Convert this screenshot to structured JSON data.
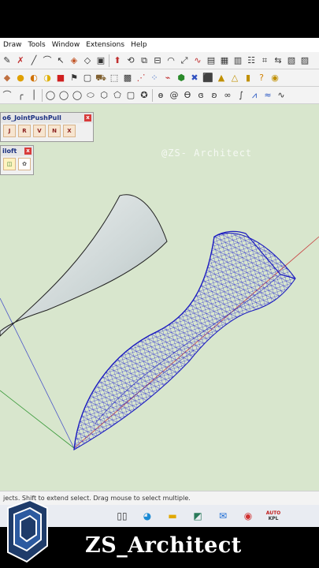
{
  "menu": [
    "Draw",
    "Tools",
    "Window",
    "Extensions",
    "Help"
  ],
  "watermark": "@ZS- Architect",
  "panel_jpp": {
    "title": "o6_JointPushPull",
    "icons": [
      "J",
      "R",
      "V",
      "N",
      "X"
    ]
  },
  "panel_loft": {
    "title": "iloft",
    "icons": [
      "loft",
      "loft-sel"
    ]
  },
  "status": "jects. Shift to extend select. Drag mouse to select multiple.",
  "taskbar": {
    "badge_top": "AUTO",
    "badge_bottom": "KPL"
  },
  "brand": "ZS_Architect",
  "colors": {
    "viewport_bg": "#d8e6cd",
    "mesh_blue": "#2020c8",
    "surface_gray": "#d9e0e0"
  }
}
